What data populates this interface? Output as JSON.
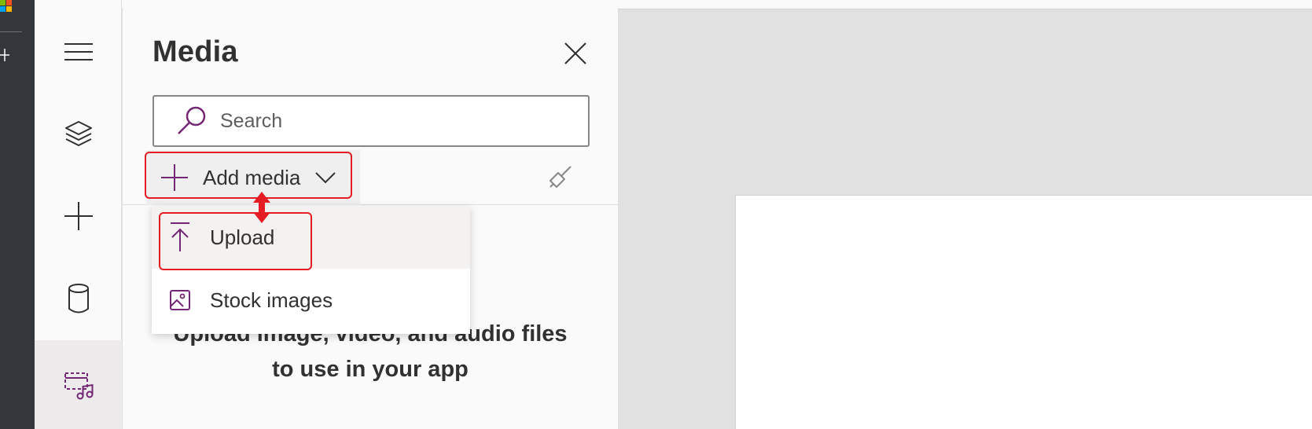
{
  "app": {
    "brand_colors": {
      "purple": "#742774",
      "highlight_red": "#e51c23"
    }
  },
  "rail": {
    "items": [
      {
        "icon": "hamburger-menu-icon"
      },
      {
        "icon": "layers-icon"
      },
      {
        "icon": "plus-icon"
      },
      {
        "icon": "database-icon"
      },
      {
        "icon": "media-icon",
        "active": true
      }
    ]
  },
  "panel": {
    "title": "Media",
    "search": {
      "placeholder": "Search",
      "value": ""
    },
    "add_media_label": "Add media",
    "empty_message_line1": "Upload image, video, and audio files",
    "empty_message_line2": "to use in your app"
  },
  "dropdown": {
    "items": [
      {
        "label": "Upload",
        "icon": "upload-icon"
      },
      {
        "label": "Stock images",
        "icon": "image-icon"
      }
    ]
  }
}
